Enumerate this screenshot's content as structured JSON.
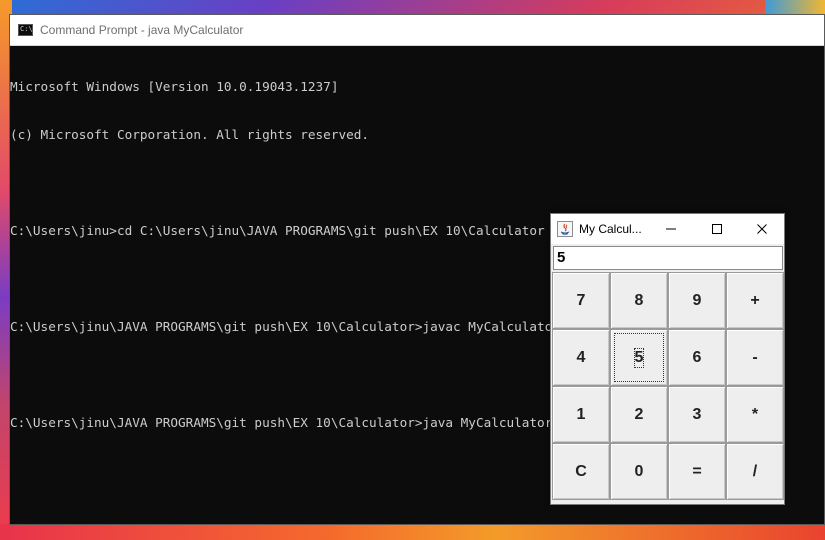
{
  "cmd": {
    "title": "Command Prompt - java  MyCalculator",
    "icon": "cmd-icon",
    "lines": [
      "Microsoft Windows [Version 10.0.19043.1237]",
      "(c) Microsoft Corporation. All rights reserved.",
      "",
      "C:\\Users\\jinu>cd C:\\Users\\jinu\\JAVA PROGRAMS\\git push\\EX 10\\Calculator",
      "",
      "C:\\Users\\jinu\\JAVA PROGRAMS\\git push\\EX 10\\Calculator>javac MyCalculator.java",
      "",
      "C:\\Users\\jinu\\JAVA PROGRAMS\\git push\\EX 10\\Calculator>java MyCalculator"
    ]
  },
  "calculator": {
    "title": "My Calcul...",
    "icon": "java-icon",
    "display_value": "5",
    "keys": [
      {
        "label": "7",
        "focused": false
      },
      {
        "label": "8",
        "focused": false
      },
      {
        "label": "9",
        "focused": false
      },
      {
        "label": "+",
        "focused": false
      },
      {
        "label": "4",
        "focused": false
      },
      {
        "label": "5",
        "focused": true
      },
      {
        "label": "6",
        "focused": false
      },
      {
        "label": "-",
        "focused": false
      },
      {
        "label": "1",
        "focused": false
      },
      {
        "label": "2",
        "focused": false
      },
      {
        "label": "3",
        "focused": false
      },
      {
        "label": "*",
        "focused": false
      },
      {
        "label": "C",
        "focused": false
      },
      {
        "label": "0",
        "focused": false
      },
      {
        "label": "=",
        "focused": false
      },
      {
        "label": "/",
        "focused": false
      }
    ]
  },
  "colors": {
    "console_bg": "#0c0c0c",
    "console_text": "#cccccc",
    "button_face": "#eeeeee"
  }
}
